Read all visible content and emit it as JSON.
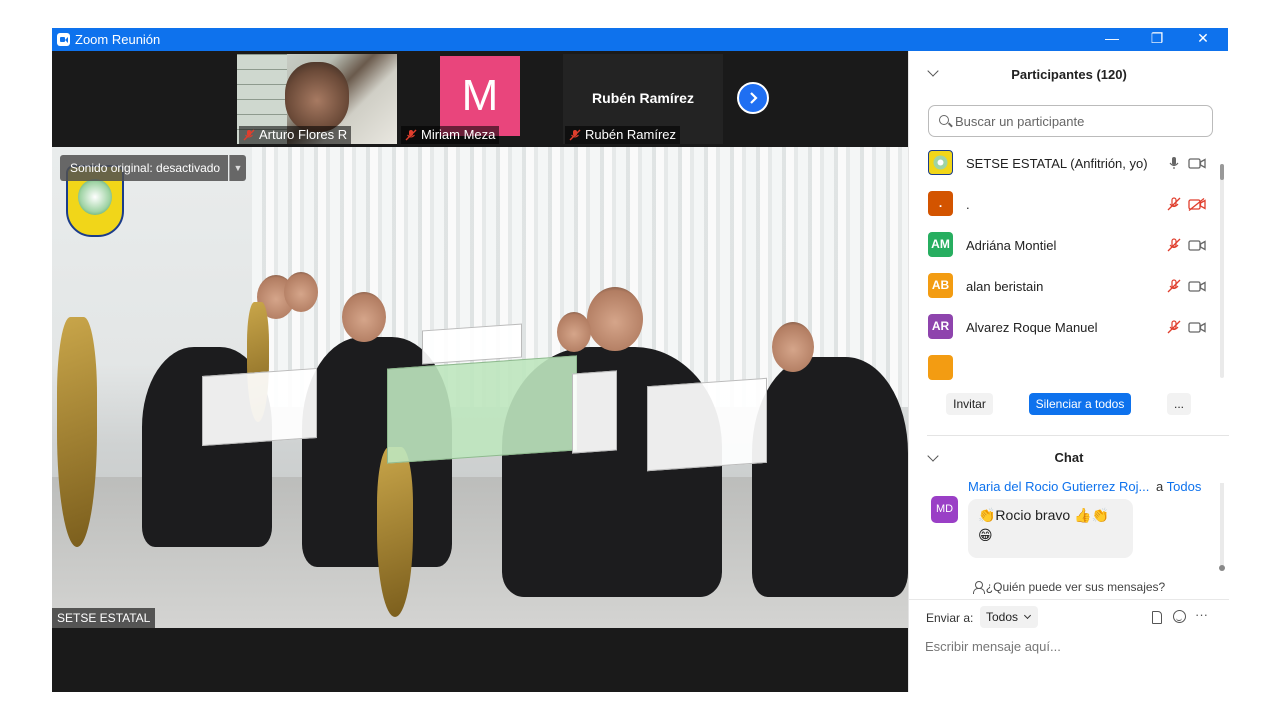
{
  "window": {
    "title": "Zoom Reunión",
    "controls": {
      "minimize": "—",
      "restore": "❐",
      "close": "✕"
    }
  },
  "thumbnails": [
    {
      "name": "Arturo Flores R",
      "muted": true
    },
    {
      "name": "Miriam Meza",
      "avatar_letter": "M",
      "avatar_color": "#e9457c",
      "muted": true
    },
    {
      "name": "Rubén Ramírez",
      "display_name": "Rubén Ramírez",
      "muted": true
    }
  ],
  "main_video": {
    "sound_toggle": "Sonido original: desactivado",
    "speaker": "SETSE ESTATAL"
  },
  "participants": {
    "title": "Participantes (120)",
    "search_placeholder": "Buscar un participante",
    "items": [
      {
        "initials": "",
        "name": "SETSE ESTATAL (Anfitrión, yo)",
        "color": "#f1d619",
        "mic_muted": false,
        "video_off": false
      },
      {
        "initials": ".",
        "name": ".",
        "color": "#d35400",
        "mic_muted": true,
        "video_off": true
      },
      {
        "initials": "AM",
        "name": "Adriána Montiel",
        "color": "#27ae60",
        "mic_muted": true,
        "video_off": false
      },
      {
        "initials": "AB",
        "name": "alan beristain",
        "color": "#f39c12",
        "mic_muted": true,
        "video_off": false
      },
      {
        "initials": "AR",
        "name": "Alvarez Roque Manuel",
        "color": "#8e44ad",
        "mic_muted": true,
        "video_off": false
      }
    ],
    "buttons": {
      "invite": "Invitar",
      "mute_all": "Silenciar a todos",
      "more": "..."
    }
  },
  "chat": {
    "title": "Chat",
    "messages": [
      {
        "initials": "MD",
        "sender": "Maria del Rocio Gutierrez Roj...",
        "to_prefix": "a",
        "to": "Todos",
        "text_line1": "👏Rocio bravo 👍👏",
        "text_line2": "😁"
      }
    ],
    "who_sees": "¿Quién puede ver sus mensajes?",
    "send_to_label": "Enviar a:",
    "send_to_value": "Todos",
    "input_placeholder": "Escribir mensaje aquí..."
  },
  "colors": {
    "accent": "#0e72ed",
    "muted_icon": "#e03e2d"
  }
}
